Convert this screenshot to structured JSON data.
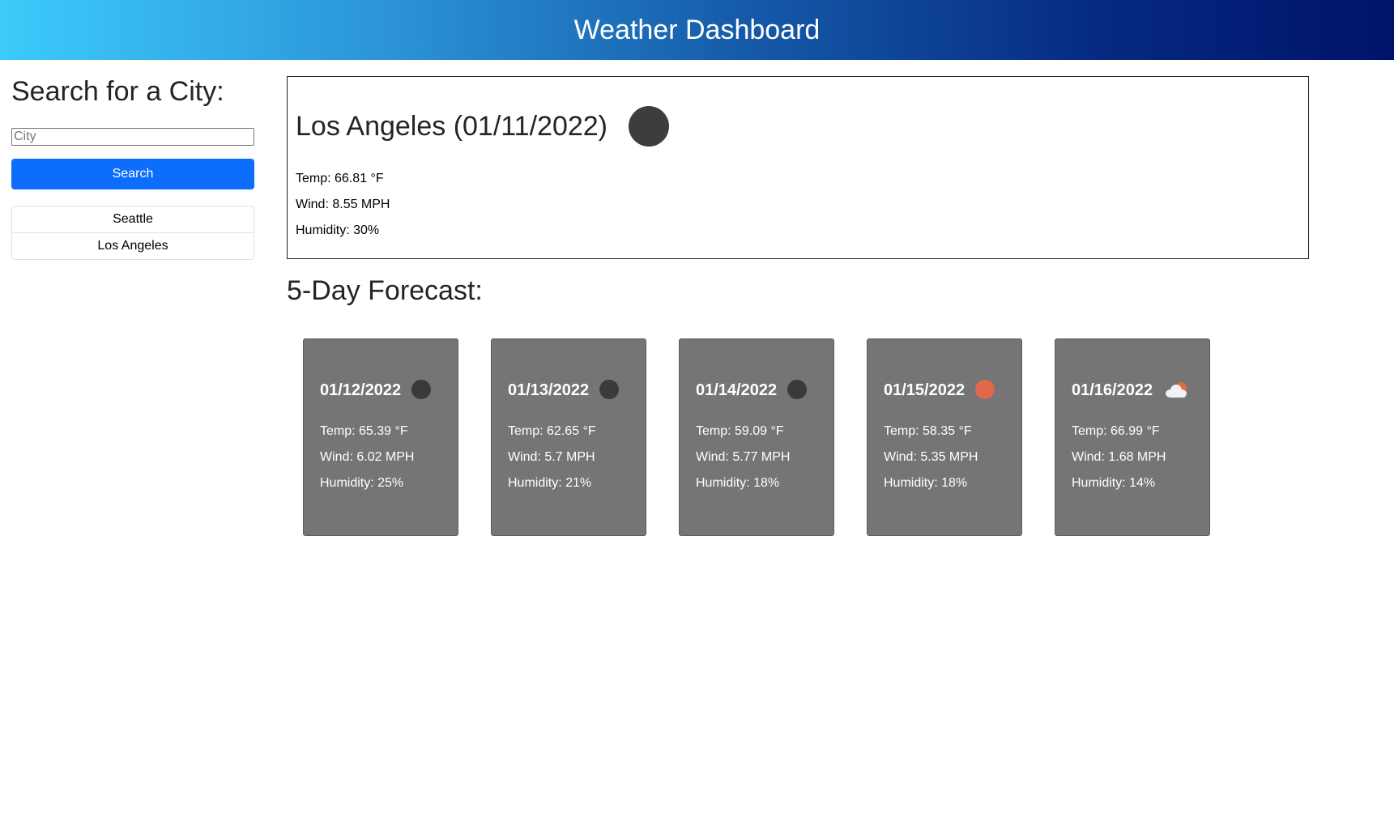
{
  "header": {
    "title": "Weather Dashboard"
  },
  "sidebar": {
    "heading": "Search for a City:",
    "input_placeholder": "City",
    "input_value": "",
    "search_label": "Search",
    "history": [
      "Seattle",
      "Los Angeles"
    ]
  },
  "current": {
    "title": "Los Angeles (01/11/2022)",
    "icon": "moon-dark-icon",
    "temp": "Temp: 66.81 °F",
    "wind": "Wind: 8.55 MPH",
    "humidity": "Humidity: 30%"
  },
  "forecast": {
    "heading": "5-Day Forecast:",
    "days": [
      {
        "date": "01/12/2022",
        "icon": "moon-dark-icon",
        "temp": "Temp: 65.39 °F",
        "wind": "Wind: 6.02 MPH",
        "humidity": "Humidity: 25%"
      },
      {
        "date": "01/13/2022",
        "icon": "moon-dark-icon",
        "temp": "Temp: 62.65 °F",
        "wind": "Wind: 5.7 MPH",
        "humidity": "Humidity: 21%"
      },
      {
        "date": "01/14/2022",
        "icon": "moon-dark-icon",
        "temp": "Temp: 59.09 °F",
        "wind": "Wind: 5.77 MPH",
        "humidity": "Humidity: 18%"
      },
      {
        "date": "01/15/2022",
        "icon": "sun-icon",
        "temp": "Temp: 58.35 °F",
        "wind": "Wind: 5.35 MPH",
        "humidity": "Humidity: 18%"
      },
      {
        "date": "01/16/2022",
        "icon": "cloud-sun-icon",
        "temp": "Temp: 66.99 °F",
        "wind": "Wind: 1.68 MPH",
        "humidity": "Humidity: 14%"
      }
    ]
  },
  "colors": {
    "search_button": "#0d6efd",
    "card_background": "#757575",
    "sun": "#e2674a",
    "moon": "#3a3a3c"
  }
}
